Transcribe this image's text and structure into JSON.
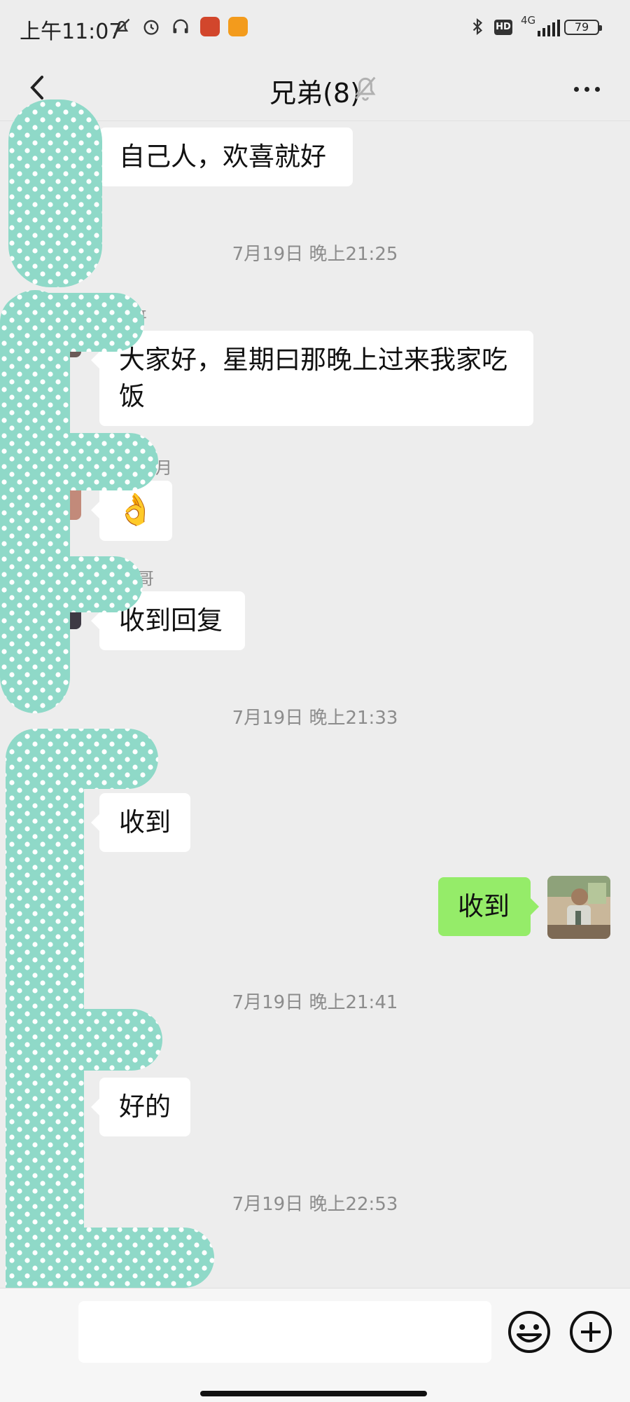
{
  "status_bar": {
    "time": "上午11:07",
    "network": "4G",
    "battery": "79"
  },
  "header": {
    "title": "兄弟(8)"
  },
  "messages": [
    {
      "kind": "text",
      "side": "left",
      "text": "自己人，欢喜就好"
    },
    {
      "kind": "time",
      "text": "7月19日 晚上21:25"
    },
    {
      "kind": "text",
      "side": "left",
      "sender": "哥",
      "text": "大家好，星期曰那晚上过来我家吃饭"
    },
    {
      "kind": "text",
      "side": "left",
      "sender": "月",
      "text": "👌"
    },
    {
      "kind": "text",
      "side": "left",
      "sender": "哥",
      "text": "收到回复"
    },
    {
      "kind": "time",
      "text": "7月19日 晚上21:33"
    },
    {
      "kind": "text",
      "side": "left",
      "sender": "",
      "text": "收到"
    },
    {
      "kind": "text",
      "side": "right",
      "text": "收到"
    },
    {
      "kind": "time",
      "text": "7月19日 晚上21:41"
    },
    {
      "kind": "text",
      "side": "left",
      "text": "好的"
    },
    {
      "kind": "time",
      "text": "7月19日 晚上22:53"
    }
  ],
  "icons": {
    "back": "chevron-left-icon",
    "mute": "bell-off-icon",
    "more": "more-dots-icon",
    "emoji": "smiley-icon",
    "plus": "plus-circle-icon"
  },
  "colors": {
    "background": "#ededed",
    "own_bubble": "#95ec69",
    "other_bubble": "#ffffff",
    "redaction": "#8fd9c8"
  }
}
